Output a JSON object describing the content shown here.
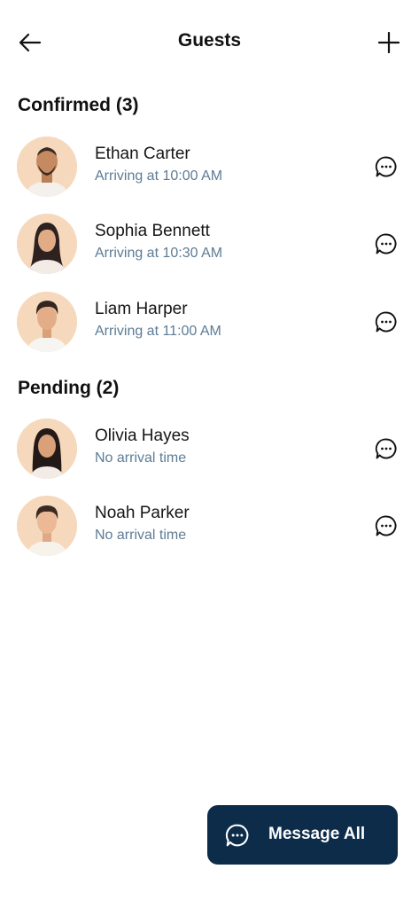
{
  "header": {
    "title": "Guests",
    "back_icon": "arrow-left-icon",
    "add_icon": "plus-icon"
  },
  "sections": [
    {
      "title": "Confirmed (3)",
      "guests": [
        {
          "name": "Ethan Carter",
          "status": "Arriving at 10:00 AM",
          "avatar": "bald-bearded-man-avatar",
          "chat_icon": "chat-bubble-icon"
        },
        {
          "name": "Sophia Bennett",
          "status": "Arriving at 10:30 AM",
          "avatar": "long-hair-woman-avatar",
          "chat_icon": "chat-bubble-icon"
        },
        {
          "name": "Liam Harper",
          "status": "Arriving at 11:00 AM",
          "avatar": "short-hair-man-avatar",
          "chat_icon": "chat-bubble-icon"
        }
      ]
    },
    {
      "title": "Pending (2)",
      "guests": [
        {
          "name": "Olivia Hayes",
          "status": "No arrival time",
          "avatar": "dark-hair-woman-avatar",
          "chat_icon": "chat-bubble-icon"
        },
        {
          "name": "Noah Parker",
          "status": "No arrival time",
          "avatar": "young-man-avatar",
          "chat_icon": "chat-bubble-icon"
        }
      ]
    }
  ],
  "footer": {
    "message_all_label": "Message All",
    "message_all_icon": "chat-bubble-icon"
  },
  "colors": {
    "accent": "#0d2c4a",
    "subtext": "#5d7c96",
    "avatar_bg": "#f6d9bc"
  }
}
